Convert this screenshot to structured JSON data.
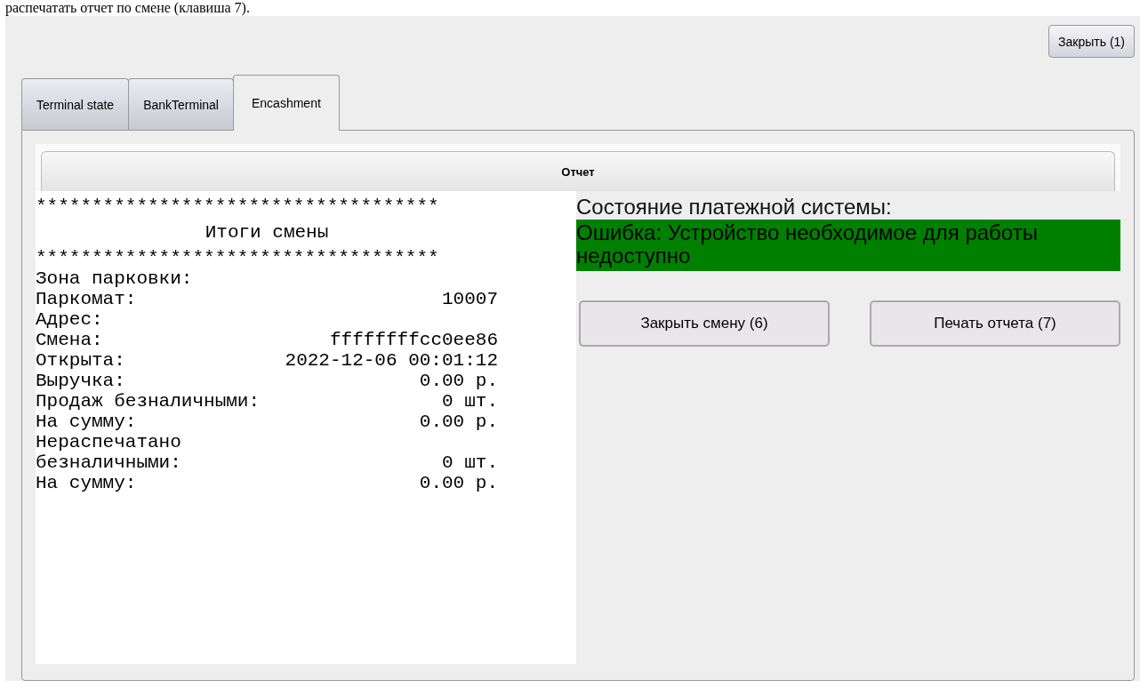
{
  "document_text": "распечатать отчет по смене (клавиша 7).",
  "close_button": "Закрыть (1)",
  "tabs": [
    {
      "label": "Terminal state",
      "selected": false
    },
    {
      "label": "BankTerminal",
      "selected": false
    },
    {
      "label": "Encashment",
      "selected": true
    }
  ],
  "section_header": "Отчет",
  "receipt": [
    {
      "kind": "rule",
      "text": "************************************"
    },
    {
      "kind": "title",
      "text": "Итоги смены"
    },
    {
      "kind": "rule",
      "text": "************************************"
    },
    {
      "kind": "field",
      "label": "Зона парковки:"
    },
    {
      "kind": "field",
      "label": "Паркомат:",
      "value": "10007"
    },
    {
      "kind": "field",
      "label": "Адрес:"
    },
    {
      "kind": "field",
      "label": "Смена:",
      "value": "ffffffffcc0ee86"
    },
    {
      "kind": "field",
      "label": "Открыта:",
      "value": "2022-12-06 00:01:12"
    },
    {
      "kind": "field",
      "label": "Выручка:",
      "value": "0.00 р."
    },
    {
      "kind": "field",
      "label": "Продаж безналичными:",
      "value": "0 шт."
    },
    {
      "kind": "field",
      "label": "На сумму:",
      "value": "0.00 р."
    },
    {
      "kind": "field",
      "label": "Нераспечатано"
    },
    {
      "kind": "field",
      "label": "безналичными:",
      "value": "0 шт."
    },
    {
      "kind": "field",
      "label": "На сумму:",
      "value": "0.00 р."
    }
  ],
  "payment_status": {
    "label": "Состояние платежной системы:",
    "message": "Ошибка: Устройство необходимое для работы недоступно",
    "color": "#008000"
  },
  "actions": [
    "Закрыть смену (6)",
    "Печать отчета (7)"
  ]
}
